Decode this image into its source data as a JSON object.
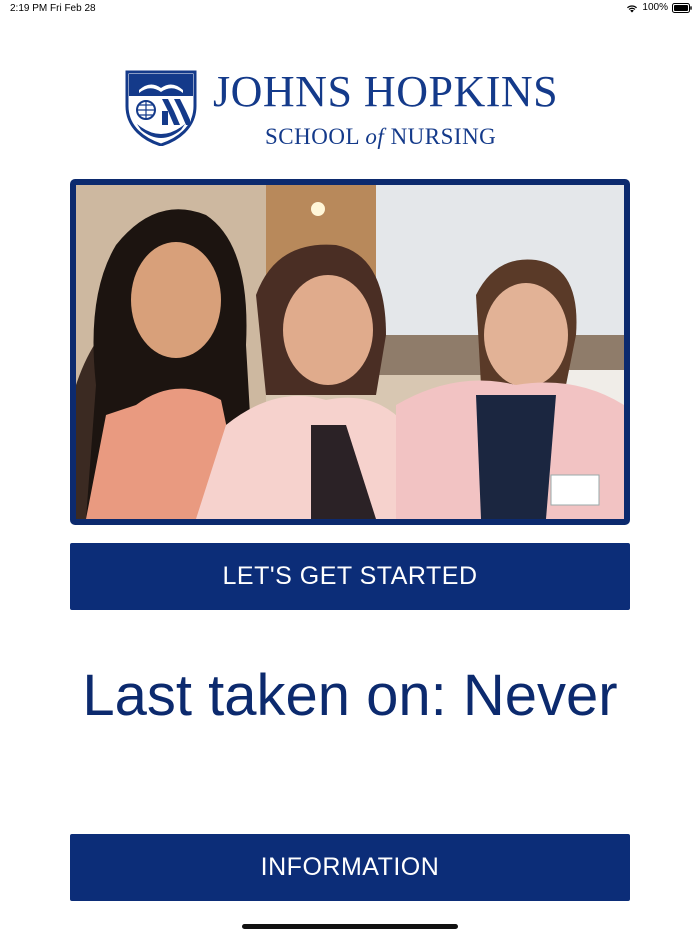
{
  "status_bar": {
    "time": "2:19 PM",
    "date": "Fri Feb 28",
    "battery": "100%",
    "icons": [
      "wifi-icon",
      "battery-icon"
    ]
  },
  "logo": {
    "title": "JOHNS HOPKINS",
    "subtitle_pre": "SCHOOL",
    "subtitle_of": "of",
    "subtitle_post": "NURSING",
    "icon": "university-shield-icon"
  },
  "photo": {
    "description_icon": "group-photo"
  },
  "buttons": {
    "start_label": "LET'S GET STARTED",
    "info_label": "INFORMATION"
  },
  "status": {
    "last_taken": "Last taken on: Never"
  },
  "colors": {
    "brand_blue": "#0c2d78",
    "background": "#ffffff"
  }
}
